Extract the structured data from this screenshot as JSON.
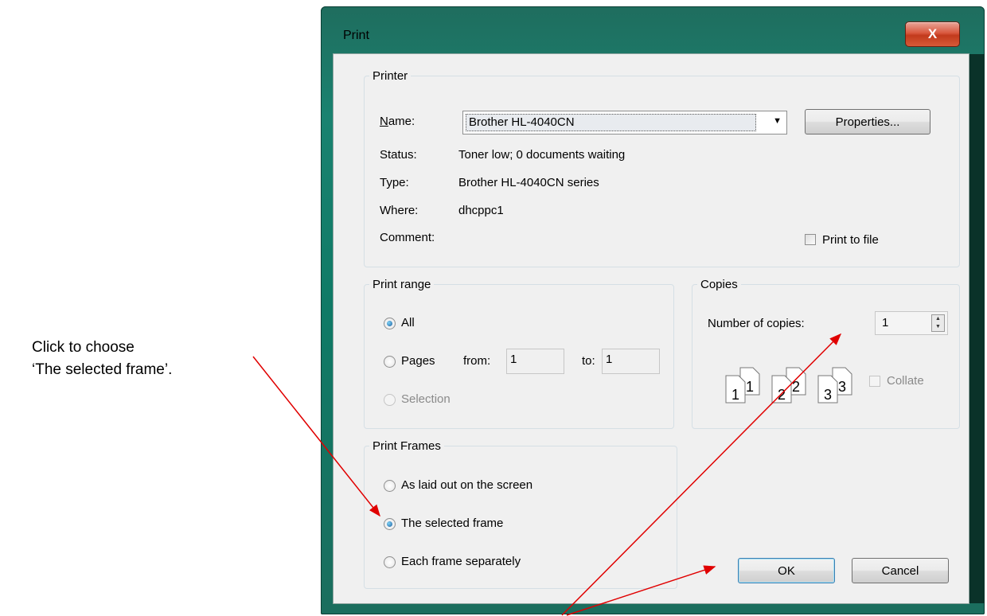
{
  "caption": {
    "line1": "Click to choose",
    "line2": "‘The selected frame’."
  },
  "window": {
    "title": "Print",
    "close_label": "X"
  },
  "printer": {
    "group_label": "Printer",
    "name_label": "Name:",
    "name_value": "Brother HL-4040CN",
    "properties_label": "Properties...",
    "status_label": "Status:",
    "status_value": "Toner low; 0 documents waiting",
    "type_label": "Type:",
    "type_value": "Brother HL-4040CN series",
    "where_label": "Where:",
    "where_value": "dhcppc1",
    "comment_label": "Comment:",
    "print_to_file_label": "Print to file"
  },
  "print_range": {
    "group_label": "Print range",
    "all_label": "All",
    "pages_label": "Pages",
    "from_label": "from:",
    "from_value": "1",
    "to_label": "to:",
    "to_value": "1",
    "selection_label": "Selection"
  },
  "copies": {
    "group_label": "Copies",
    "number_label": "Number of copies:",
    "number_value": "1",
    "collate_label": "Collate",
    "page_icons": [
      "1",
      "1",
      "2",
      "2",
      "3",
      "3"
    ]
  },
  "print_frames": {
    "group_label": "Print Frames",
    "options": [
      "As laid out on the screen",
      "The selected frame",
      "Each frame separately"
    ],
    "selected_index": 1
  },
  "buttons": {
    "ok_label": "OK",
    "cancel_label": "Cancel"
  },
  "colors": {
    "annotation_arrow": "#e00000",
    "window_frame": "#1a8270"
  }
}
